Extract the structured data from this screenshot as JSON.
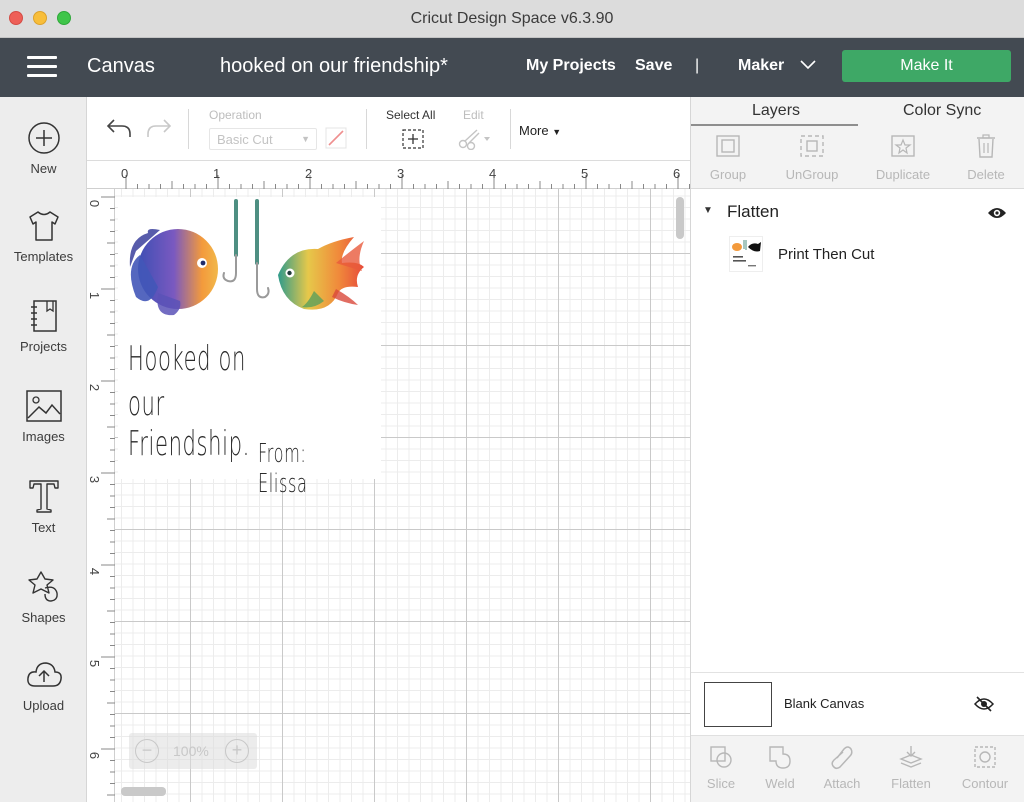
{
  "window": {
    "title": "Cricut Design Space  v6.3.90"
  },
  "header": {
    "canvas_label": "Canvas",
    "project_name": "hooked on our friendship*",
    "my_projects": "My Projects",
    "save": "Save",
    "separator": "|",
    "machine": "Maker",
    "make_it": "Make It"
  },
  "sidebar": {
    "items": [
      {
        "label": "New",
        "icon": "plus-circle-icon"
      },
      {
        "label": "Templates",
        "icon": "tshirt-icon"
      },
      {
        "label": "Projects",
        "icon": "notebook-icon"
      },
      {
        "label": "Images",
        "icon": "image-icon"
      },
      {
        "label": "Text",
        "icon": "text-t-icon"
      },
      {
        "label": "Shapes",
        "icon": "shapes-icon"
      },
      {
        "label": "Upload",
        "icon": "cloud-upload-icon"
      }
    ]
  },
  "toolbar": {
    "operation_label": "Operation",
    "operation_value": "Basic Cut",
    "select_all": "Select All",
    "edit": "Edit",
    "more": "More"
  },
  "canvas": {
    "ruler_top": [
      "0",
      "1",
      "2",
      "3",
      "4",
      "5",
      "6"
    ],
    "ruler_left": [
      "0",
      "1",
      "2",
      "3",
      "4",
      "5",
      "6"
    ],
    "zoom": "100%",
    "design": {
      "line1": "Hooked on",
      "line2": "our Friendship.",
      "from": "From: Elissa"
    }
  },
  "panel": {
    "tabs": [
      "Layers",
      "Color Sync"
    ],
    "actions": [
      "Group",
      "UnGroup",
      "Duplicate",
      "Delete"
    ],
    "group_name": "Flatten",
    "layer_name": "Print Then Cut",
    "blank_canvas": "Blank Canvas",
    "bottom_actions": [
      "Slice",
      "Weld",
      "Attach",
      "Flatten",
      "Contour"
    ]
  },
  "colors": {
    "header_bg": "#434a52",
    "make_it_green": "#3ea866",
    "hook_teal": "#4e8f82"
  }
}
